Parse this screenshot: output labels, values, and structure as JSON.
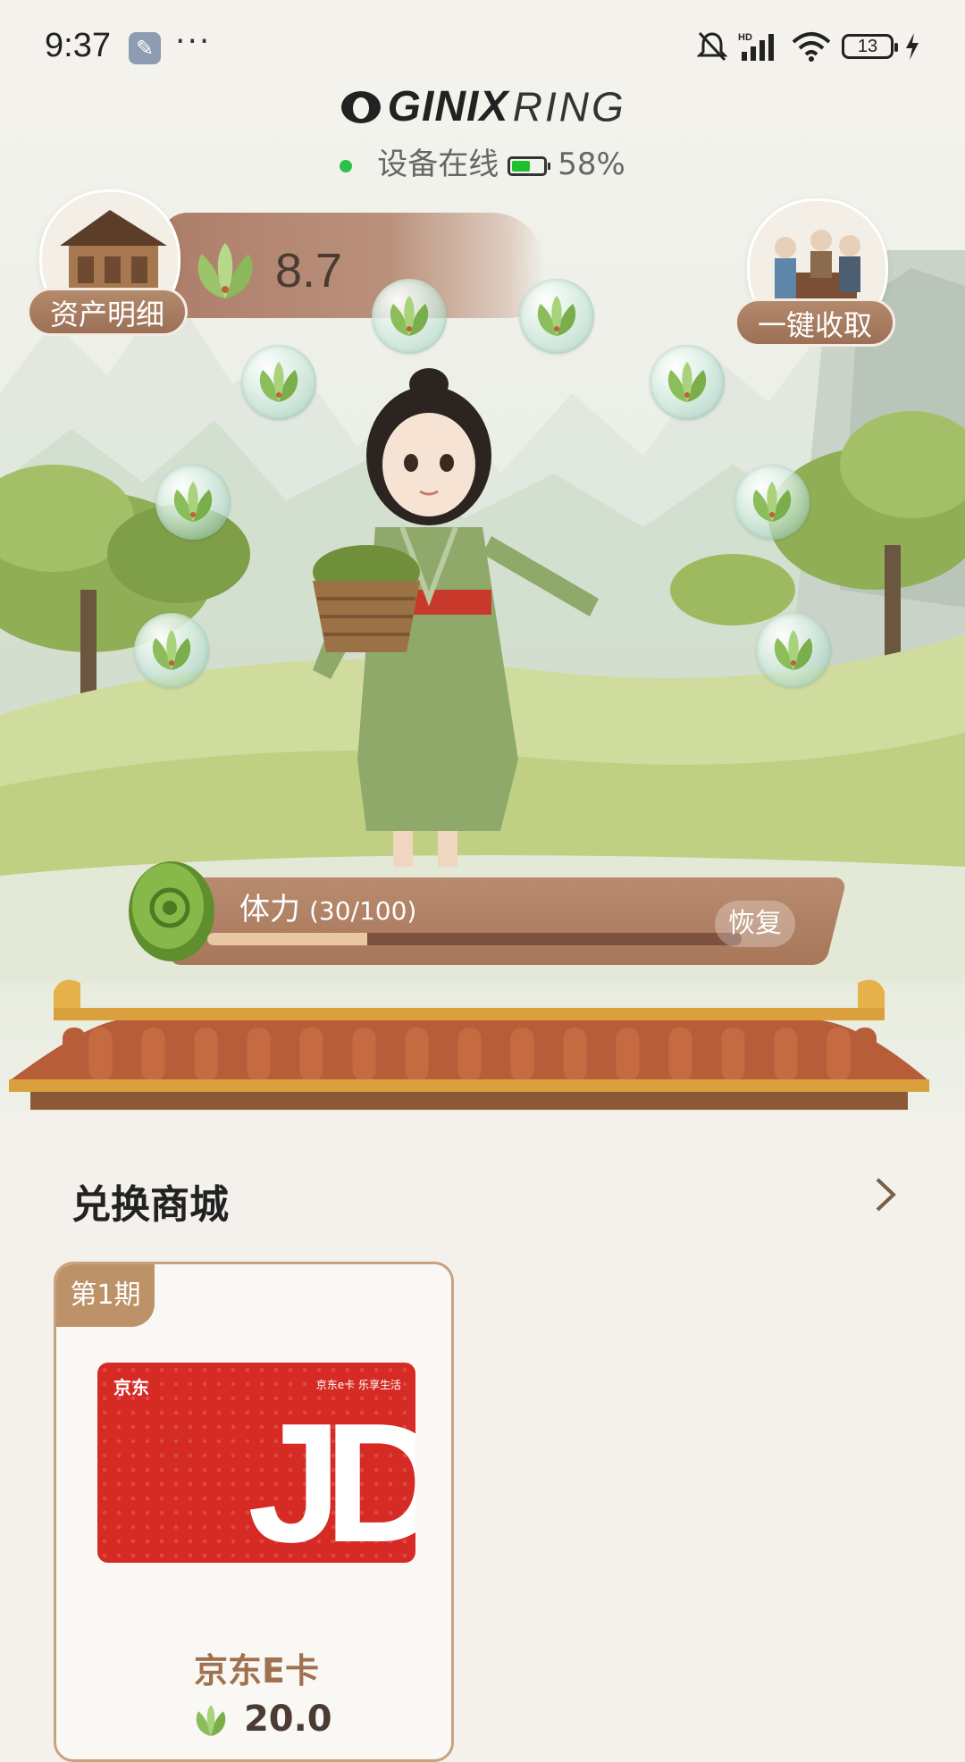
{
  "status_bar": {
    "time": "9:37",
    "more": "···",
    "battery": "13"
  },
  "brand": {
    "name": "GINIX",
    "suffix": "RING"
  },
  "device": {
    "status": "设备在线",
    "battery": "58%",
    "battery_level": 0.58
  },
  "wallet": {
    "balance": "8.7",
    "asset_detail_label": "资产明细",
    "collect_all_label": "一键收取"
  },
  "stamina": {
    "label": "体力",
    "value_text": "(30/100)",
    "current": 30,
    "max": 100,
    "restore_label": "恢复"
  },
  "mall": {
    "title": "兑换商城",
    "cards": [
      {
        "issue": "第1期",
        "brand_logo": "京东",
        "slogan": "京东e卡 乐享生活",
        "big_text": "JD",
        "name": "京东E卡",
        "price": "20.0"
      }
    ]
  },
  "colors": {
    "accent": "#a8775a",
    "brush": "#b08368",
    "green": "#2fbf4b",
    "jd_red": "#d62a24"
  }
}
